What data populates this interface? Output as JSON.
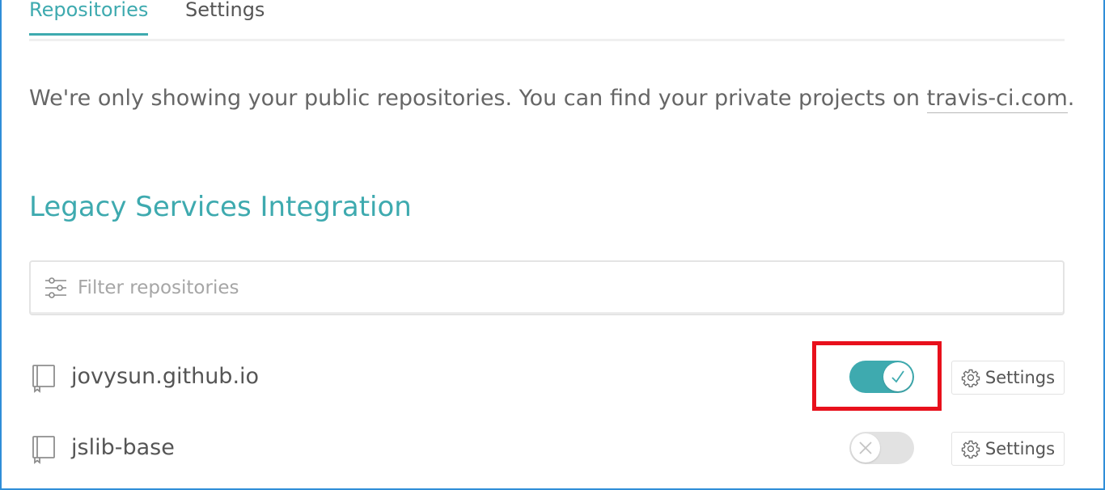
{
  "tabs": [
    {
      "label": "Repositories",
      "active": true
    },
    {
      "label": "Settings",
      "active": false
    }
  ],
  "notice": {
    "text": "We're only showing your public repositories. You can find your private projects on ",
    "link_text": "travis-ci.com",
    "suffix": "."
  },
  "section_title": "Legacy Services Integration",
  "filter": {
    "placeholder": "Filter repositories",
    "value": "",
    "icon": "filter-sliders-icon"
  },
  "repositories": [
    {
      "name": "jovysun.github.io",
      "enabled": true,
      "settings_label": "Settings",
      "icon": "repo-book-icon"
    },
    {
      "name": "jslib-base",
      "enabled": false,
      "settings_label": "Settings",
      "icon": "repo-book-icon"
    }
  ],
  "colors": {
    "accent": "#3eaaaf",
    "highlight": "#e8101c",
    "frame": "#2f8ed8",
    "toggle_off": "#e2e2e2"
  }
}
